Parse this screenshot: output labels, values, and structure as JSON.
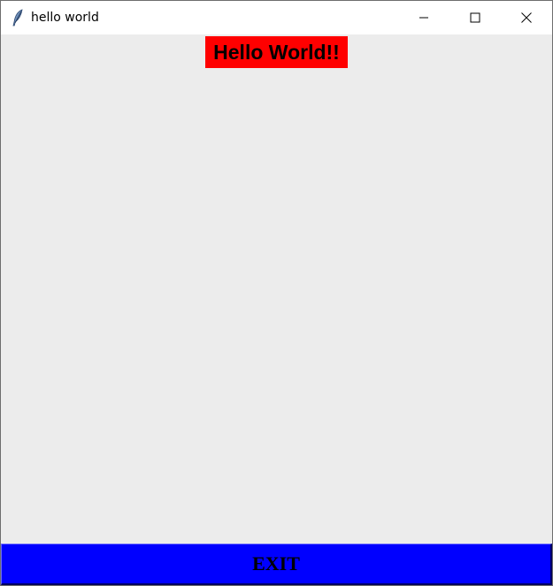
{
  "window": {
    "title": "hello world",
    "app_icon": "feather-icon",
    "controls": {
      "minimize_icon": "minimize-icon",
      "maximize_icon": "maximize-icon",
      "close_icon": "close-icon"
    }
  },
  "main": {
    "hello_label": "Hello World!!",
    "hello_label_bg": "#ff0000",
    "exit_button_label": "EXIT",
    "exit_button_bg": "#0000ff",
    "background": "#ececec"
  }
}
